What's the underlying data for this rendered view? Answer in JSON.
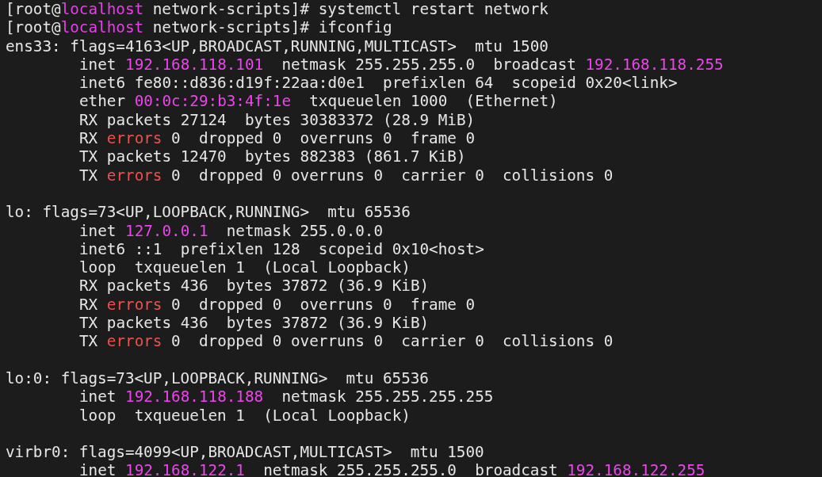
{
  "terminal": {
    "commands": [
      [
        {
          "kind": "plain",
          "text": "[root@"
        },
        {
          "kind": "host",
          "text": "localhost"
        },
        {
          "kind": "plain",
          "text": " network-scripts]# systemctl restart network"
        }
      ],
      [
        {
          "kind": "plain",
          "text": "[root@"
        },
        {
          "kind": "host",
          "text": "localhost"
        },
        {
          "kind": "plain",
          "text": " network-scripts]# ifconfig"
        }
      ]
    ],
    "interfaces": [
      {
        "header": [
          {
            "kind": "plain",
            "text": "ens33: flags=4163<UP,BROADCAST,RUNNING,MULTICAST>  mtu 1500"
          }
        ],
        "details": [
          [
            {
              "kind": "plain",
              "text": "inet "
            },
            {
              "kind": "address",
              "text": "192.168.118.101"
            },
            {
              "kind": "plain",
              "text": "  netmask 255.255.255.0  broadcast "
            },
            {
              "kind": "address",
              "text": "192.168.118.255"
            }
          ],
          [
            {
              "kind": "plain",
              "text": "inet6 fe80::d836:d19f:22aa:d0e1  prefixlen 64  scopeid 0x20<link>"
            }
          ],
          [
            {
              "kind": "plain",
              "text": "ether "
            },
            {
              "kind": "address",
              "text": "00:0c:29:b3:4f:1e"
            },
            {
              "kind": "plain",
              "text": "  txqueuelen 1000  (Ethernet)"
            }
          ],
          [
            {
              "kind": "plain",
              "text": "RX packets 27124  bytes 30383372 (28.9 MiB)"
            }
          ],
          [
            {
              "kind": "plain",
              "text": "RX "
            },
            {
              "kind": "error",
              "text": "errors"
            },
            {
              "kind": "plain",
              "text": " 0  dropped 0  overruns 0  frame 0"
            }
          ],
          [
            {
              "kind": "plain",
              "text": "TX packets 12470  bytes 882383 (861.7 KiB)"
            }
          ],
          [
            {
              "kind": "plain",
              "text": "TX "
            },
            {
              "kind": "error",
              "text": "errors"
            },
            {
              "kind": "plain",
              "text": " 0  dropped 0 overruns 0  carrier 0  collisions 0"
            }
          ]
        ]
      },
      {
        "header": [
          {
            "kind": "plain",
            "text": "lo: flags=73<UP,LOOPBACK,RUNNING>  mtu 65536"
          }
        ],
        "details": [
          [
            {
              "kind": "plain",
              "text": "inet "
            },
            {
              "kind": "address",
              "text": "127.0.0.1"
            },
            {
              "kind": "plain",
              "text": "  netmask 255.0.0.0"
            }
          ],
          [
            {
              "kind": "plain",
              "text": "inet6 ::1  prefixlen 128  scopeid 0x10<host>"
            }
          ],
          [
            {
              "kind": "plain",
              "text": "loop  txqueuelen 1  (Local Loopback)"
            }
          ],
          [
            {
              "kind": "plain",
              "text": "RX packets 436  bytes 37872 (36.9 KiB)"
            }
          ],
          [
            {
              "kind": "plain",
              "text": "RX "
            },
            {
              "kind": "error",
              "text": "errors"
            },
            {
              "kind": "plain",
              "text": " 0  dropped 0  overruns 0  frame 0"
            }
          ],
          [
            {
              "kind": "plain",
              "text": "TX packets 436  bytes 37872 (36.9 KiB)"
            }
          ],
          [
            {
              "kind": "plain",
              "text": "TX "
            },
            {
              "kind": "error",
              "text": "errors"
            },
            {
              "kind": "plain",
              "text": " 0  dropped 0 overruns 0  carrier 0  collisions 0"
            }
          ]
        ]
      },
      {
        "header": [
          {
            "kind": "plain",
            "text": "lo:0: flags=73<UP,LOOPBACK,RUNNING>  mtu 65536"
          }
        ],
        "details": [
          [
            {
              "kind": "plain",
              "text": "inet "
            },
            {
              "kind": "address",
              "text": "192.168.118.188"
            },
            {
              "kind": "plain",
              "text": "  netmask 255.255.255.255"
            }
          ],
          [
            {
              "kind": "plain",
              "text": "loop  txqueuelen 1  (Local Loopback)"
            }
          ]
        ]
      },
      {
        "header": [
          {
            "kind": "plain",
            "text": "virbr0: flags=4099<UP,BROADCAST,MULTICAST>  mtu 1500"
          }
        ],
        "details": [
          [
            {
              "kind": "plain",
              "text": "inet "
            },
            {
              "kind": "address",
              "text": "192.168.122.1"
            },
            {
              "kind": "plain",
              "text": "  netmask 255.255.255.0  broadcast "
            },
            {
              "kind": "address",
              "text": "192.168.122.255"
            }
          ]
        ]
      }
    ]
  }
}
